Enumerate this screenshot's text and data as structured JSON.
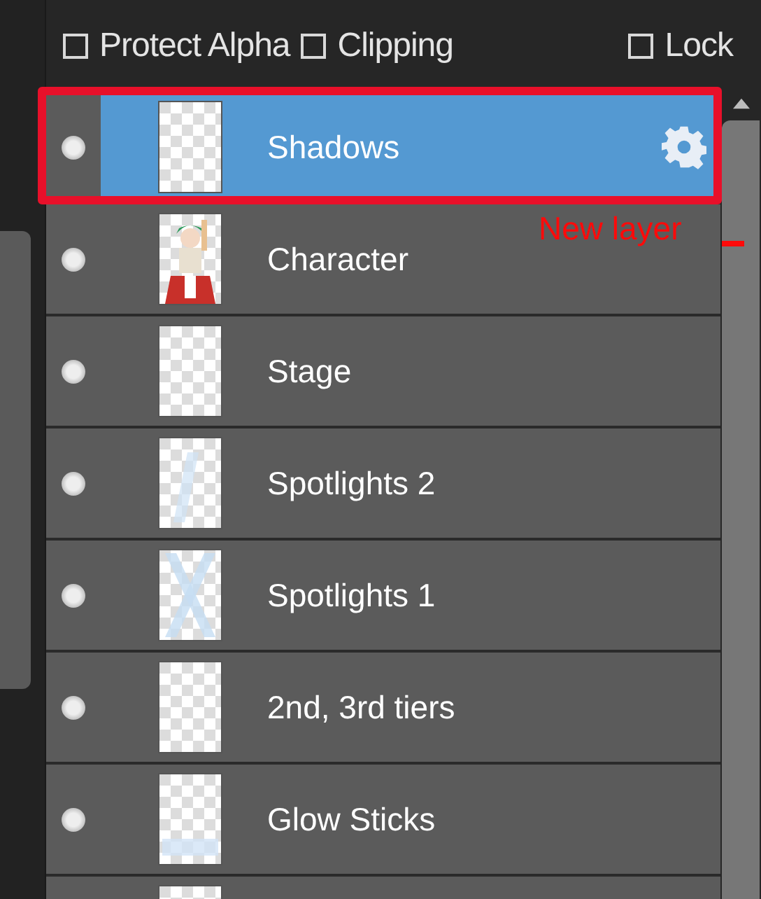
{
  "options": [
    {
      "label": "Protect Alpha",
      "checked": false
    },
    {
      "label": "Clipping",
      "checked": false
    },
    {
      "label": "Lock",
      "checked": false
    }
  ],
  "layers": [
    {
      "name": "Shadows",
      "kind": "blank",
      "selected": true
    },
    {
      "name": "Character",
      "kind": "picture",
      "selected": false
    },
    {
      "name": "Stage",
      "kind": "blank",
      "selected": false
    },
    {
      "name": "Spotlights 2",
      "kind": "faint",
      "selected": false
    },
    {
      "name": "Spotlights 1",
      "kind": "cross",
      "selected": false
    },
    {
      "name": "2nd, 3rd tiers",
      "kind": "blank",
      "selected": false
    },
    {
      "name": "Glow Sticks",
      "kind": "glow",
      "selected": false
    },
    {
      "kind": "blank",
      "selected": false
    }
  ],
  "annotation": {
    "text": "New layer"
  }
}
